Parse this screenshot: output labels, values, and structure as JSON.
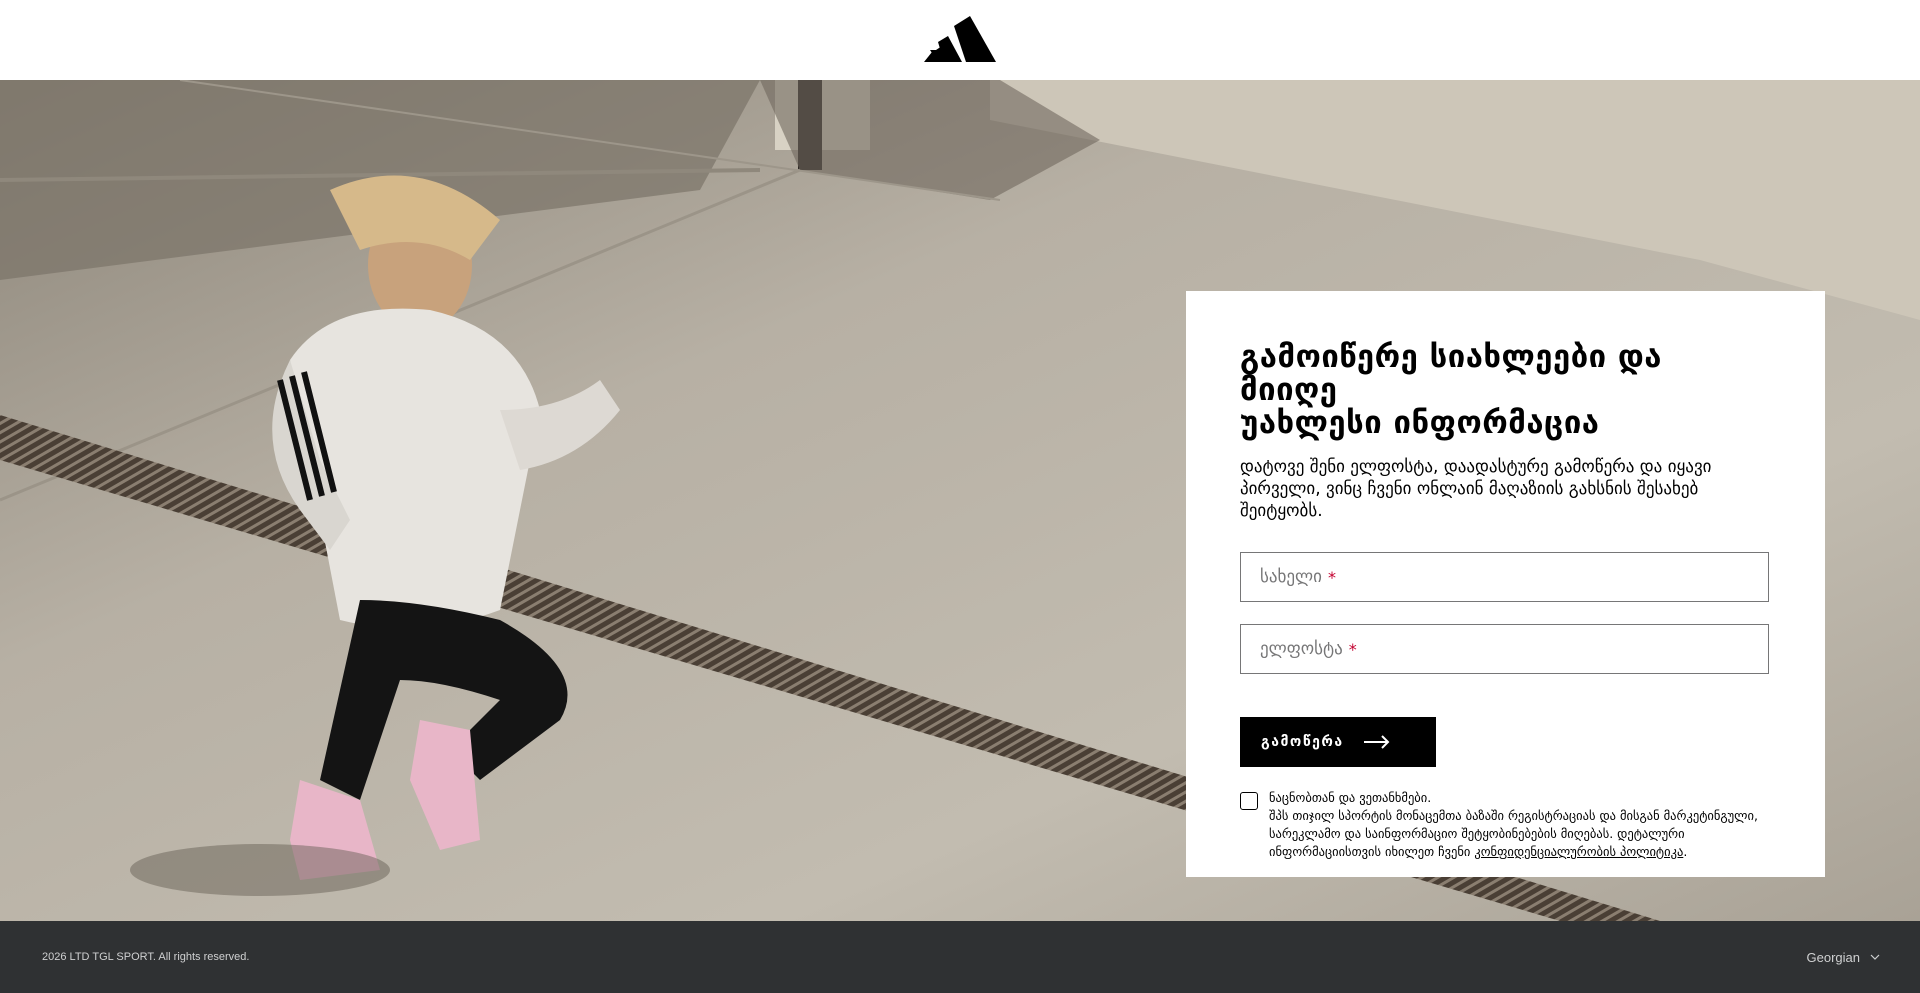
{
  "header": {
    "logo_icon": "adidas-performance-logo-icon"
  },
  "hero": {
    "image": "woman-running-on-concrete-rooftop"
  },
  "signup": {
    "title": "გამოიწერე სიახლეები და მიიღე\nუახლესი ინფორმაცია",
    "subtitle": "დატოვე შენი ელფოსტა, დაადასტურე გამოწერა და იყავი პირველი, ვინც ჩვენი ონლაინ მაღაზიის გახსნის შესახებ შეიტყობს.",
    "name_field": {
      "placeholder": "სახელი",
      "required_mark": "*",
      "value": ""
    },
    "email_field": {
      "placeholder": "ელფოსტა",
      "required_mark": "*",
      "value": ""
    },
    "submit_label": "გამოწერა",
    "submit_icon": "arrow-right-icon",
    "consent": {
      "checked": false,
      "line1": "ნაცნობთან და ვეთანხმები.",
      "line2": "შპს თიჯილ სპორტის მონაცემთა ბაზაში რეგისტრაციას და მისგან მარკეტინგული,",
      "line3": "სარეკლამო და საინფორმაციო შეტყობინებების მიღებას. დეტალური",
      "line4_prefix": "ინფორმაციისთვის იხილეთ ჩვენი ",
      "privacy_link": "კონფიდენციალურობის პოლიტიკა",
      "line4_suffix": "."
    }
  },
  "footer": {
    "copyright": "2026 LTD TGL SPORT. All rights reserved.",
    "language": "Georgian",
    "language_icon": "chevron-down-icon"
  },
  "colors": {
    "footer_bg": "#2f3133",
    "button_bg": "#000000",
    "required": "#c3002f"
  }
}
